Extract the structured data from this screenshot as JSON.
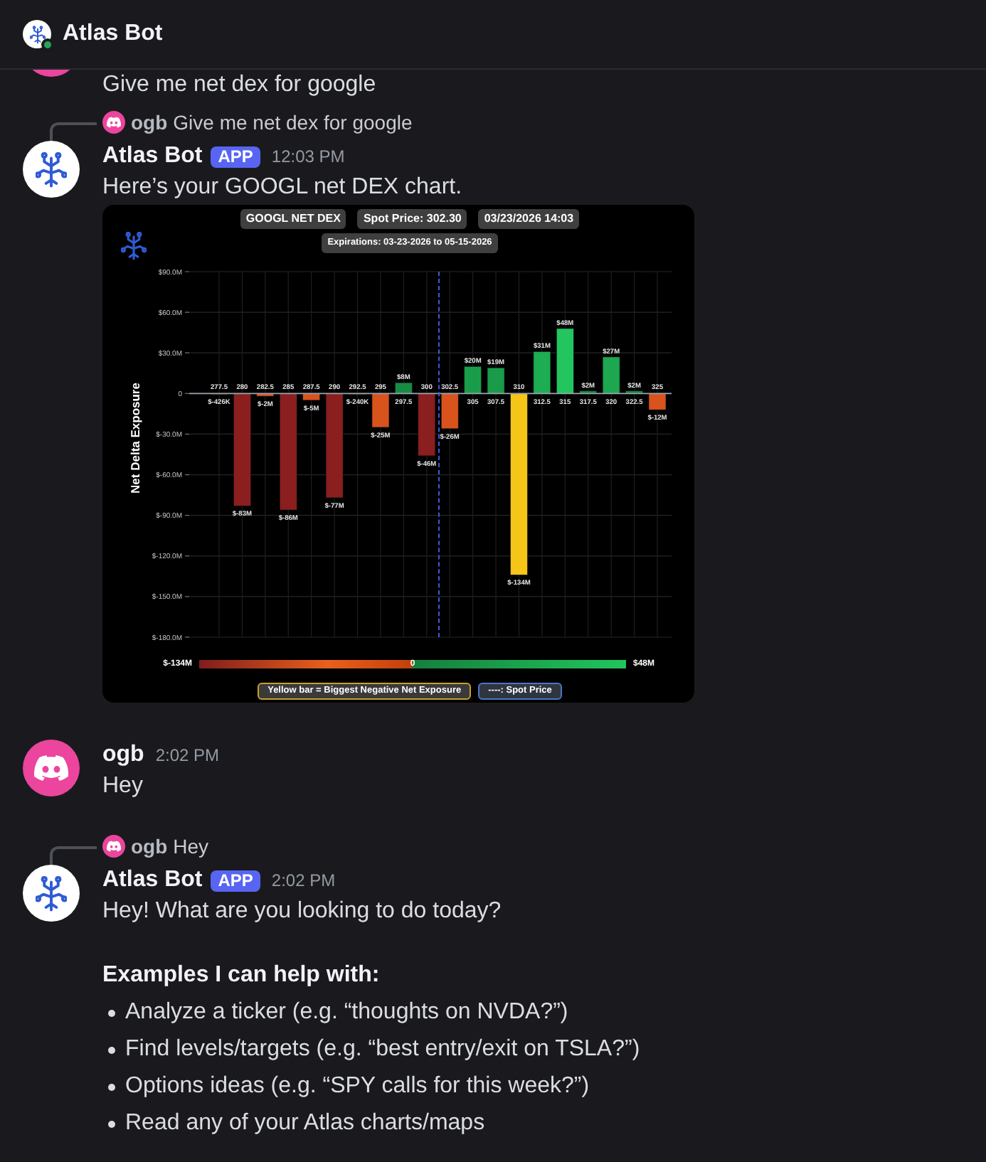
{
  "header": {
    "title": "Atlas Bot",
    "online": true
  },
  "messages": [
    {
      "kind": "user",
      "paragraphs": [
        "Give me net dex for google"
      ]
    },
    {
      "kind": "bot",
      "reply": {
        "kind": "user",
        "author": "ogb",
        "text": "Give me net dex for google"
      },
      "author": "Atlas Bot",
      "badge": "APP",
      "time": "12:03 PM",
      "paragraphs": [
        "Here’s your GOOGL net DEX chart."
      ],
      "attachment": {
        "title_pills": [
          "GOOGL NET DEX",
          "Spot Price: 302.30",
          "03/23/2026 14:03"
        ],
        "subtitle": "Expirations: 03-23-2026 to 05-15-2026",
        "chart_data": {
          "type": "bar",
          "ylabel": "Net Delta Exposure",
          "grid": true,
          "categories": [
            "277.5",
            "280",
            "282.5",
            "285",
            "287.5",
            "290",
            "292.5",
            "295",
            "297.5",
            "300",
            "302.5",
            "305",
            "307.5",
            "310",
            "312.5",
            "315",
            "317.5",
            "320",
            "322.5",
            "325"
          ],
          "values": [
            -426000,
            -83000000,
            -2000000,
            -86000000,
            -5000000,
            -77000000,
            -240000,
            -25000000,
            8000000,
            -46000000,
            -26000000,
            20000000,
            19000000,
            -134000000,
            31000000,
            48000000,
            2000000,
            27000000,
            2000000,
            -12000000
          ],
          "ylim": [
            -180000000,
            90000000
          ],
          "yticks": [
            {
              "value": 90000000,
              "label": "$90.0M"
            },
            {
              "value": 60000000,
              "label": "$60.0M"
            },
            {
              "value": 30000000,
              "label": "$30.0M"
            },
            {
              "value": 0,
              "label": "0"
            },
            {
              "value": -30000000,
              "label": "$-30.0M"
            },
            {
              "value": -60000000,
              "label": "$-60.0M"
            },
            {
              "value": -90000000,
              "label": "$-90.0M"
            },
            {
              "value": -120000000,
              "label": "$-120.0M"
            },
            {
              "value": -150000000,
              "label": "$-150.0M"
            },
            {
              "value": -180000000,
              "label": "$-180.0M"
            }
          ],
          "value_labels": [
            "$-426K",
            "$-83M",
            "$-2M",
            "$-86M",
            "$-5M",
            "$-77M",
            "$-240K",
            "$-25M",
            "$8M",
            "$-46M",
            "$-26M",
            "$20M",
            "$19M",
            "$-134M",
            "$31M",
            "$48M",
            "$2M",
            "$27M",
            "$2M",
            "$-12M"
          ]
        },
        "scale": {
          "min_label": "$-134M",
          "zero_label": "0",
          "max_label": "$48M"
        },
        "legend": [
          {
            "kind": "highlight",
            "text": "Yellow bar = Biggest Negative Net Exposure"
          },
          {
            "kind": "spot",
            "text": "----: Spot Price"
          }
        ]
      }
    },
    {
      "kind": "user",
      "author": "ogb",
      "time": "2:02 PM",
      "paragraphs": [
        "Hey"
      ]
    },
    {
      "kind": "bot",
      "reply": {
        "kind": "user",
        "author": "ogb",
        "text": "Hey"
      },
      "author": "Atlas Bot",
      "badge": "APP",
      "time": "2:02 PM",
      "paragraphs": [
        "Hey! What are you looking to do today?"
      ],
      "heading": "Examples I can help with:",
      "bullets": [
        "Analyze a ticker (e.g. “thoughts on NVDA?”)",
        "Find levels/targets (e.g. “best entry/exit on TSLA?”)",
        "Options ideas (e.g. “SPY calls for this week?”)",
        "Read any of your Atlas charts/maps"
      ]
    }
  ]
}
